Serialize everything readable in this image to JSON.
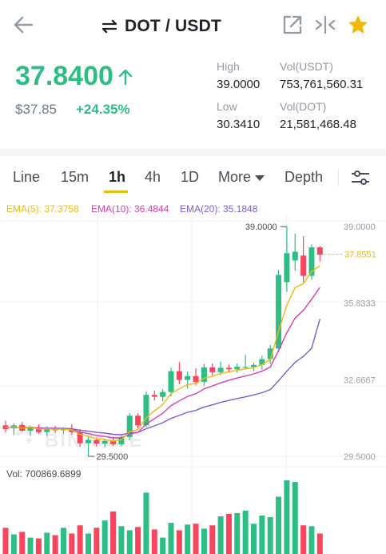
{
  "header": {
    "title": "DOT / USDT",
    "back_icon": "back-arrow-icon",
    "swap_icon": "swap-arrows-icon",
    "share_icon": "external-share-icon",
    "compare_icon": "collapse-compare-icon",
    "favorite_icon": "star-icon",
    "accent_color": "#f0b90b"
  },
  "summary": {
    "last_price": "37.8400",
    "fiat_price": "$37.85",
    "change_pct": "+24.35%",
    "up_color": "#2ebd85",
    "down_color": "#f6465d",
    "high_label": "High",
    "high_value": "39.0000",
    "low_label": "Low",
    "low_value": "30.3410",
    "vol_quote_label": "Vol(USDT)",
    "vol_quote_value": "753,761,560.31",
    "vol_base_label": "Vol(DOT)",
    "vol_base_value": "21,581,468.48"
  },
  "tabs": [
    {
      "label": "Line"
    },
    {
      "label": "15m"
    },
    {
      "label": "1h",
      "active": true
    },
    {
      "label": "4h"
    },
    {
      "label": "1D"
    },
    {
      "label": "More"
    },
    {
      "label": "Depth"
    }
  ],
  "settings_icon": "sliders-settings-icon",
  "ema": {
    "ema5": "EMA(5): 37.3758",
    "ema10": "EMA(10): 36.4844",
    "ema20": "EMA(20): 35.1848",
    "ema5_color": "#f0b90b",
    "ema10_color": "#d63fb0",
    "ema20_color": "#7b5bd6"
  },
  "chart_data": {
    "type": "candlestick",
    "y_ticks": [
      "39.0000",
      "35.8333",
      "32.6667",
      "29.5000"
    ],
    "ylim": [
      29.5,
      39.0
    ],
    "high_marker": "39.0000",
    "low_marker": "29.5000",
    "last_price_marker": "37.8551",
    "watermark": "BINANCE",
    "volume_label": "Vol: 700869.6899",
    "candles": [
      {
        "o": 30.78,
        "h": 30.98,
        "l": 30.48,
        "c": 30.62
      },
      {
        "o": 30.66,
        "h": 30.86,
        "l": 30.38,
        "c": 30.78
      },
      {
        "o": 30.8,
        "h": 30.92,
        "l": 30.5,
        "c": 30.56
      },
      {
        "o": 30.56,
        "h": 30.76,
        "l": 30.34,
        "c": 30.72
      },
      {
        "o": 30.7,
        "h": 30.82,
        "l": 30.44,
        "c": 30.5
      },
      {
        "o": 30.5,
        "h": 30.74,
        "l": 30.34,
        "c": 30.66
      },
      {
        "o": 30.66,
        "h": 30.76,
        "l": 30.46,
        "c": 30.58
      },
      {
        "o": 30.58,
        "h": 30.7,
        "l": 30.42,
        "c": 30.64
      },
      {
        "o": 30.64,
        "h": 30.82,
        "l": 30.4,
        "c": 30.5
      },
      {
        "o": 30.5,
        "h": 30.62,
        "l": 29.9,
        "c": 30.04
      },
      {
        "o": 30.04,
        "h": 30.3,
        "l": 29.5,
        "c": 30.18
      },
      {
        "o": 30.18,
        "h": 30.28,
        "l": 29.9,
        "c": 30.02
      },
      {
        "o": 30.02,
        "h": 30.22,
        "l": 29.86,
        "c": 30.14
      },
      {
        "o": 30.14,
        "h": 30.32,
        "l": 29.92,
        "c": 30.0
      },
      {
        "o": 30.0,
        "h": 30.4,
        "l": 29.92,
        "c": 30.3
      },
      {
        "o": 30.3,
        "h": 31.28,
        "l": 30.16,
        "c": 31.18
      },
      {
        "o": 31.18,
        "h": 31.28,
        "l": 30.66,
        "c": 30.78
      },
      {
        "o": 30.78,
        "h": 32.18,
        "l": 30.7,
        "c": 32.04
      },
      {
        "o": 32.04,
        "h": 32.22,
        "l": 31.82,
        "c": 31.96
      },
      {
        "o": 31.96,
        "h": 32.28,
        "l": 31.76,
        "c": 32.16
      },
      {
        "o": 32.16,
        "h": 33.16,
        "l": 31.98,
        "c": 33.02
      },
      {
        "o": 33.02,
        "h": 33.4,
        "l": 32.48,
        "c": 32.66
      },
      {
        "o": 32.66,
        "h": 33.0,
        "l": 32.3,
        "c": 32.82
      },
      {
        "o": 32.82,
        "h": 33.14,
        "l": 32.44,
        "c": 32.58
      },
      {
        "o": 32.58,
        "h": 33.32,
        "l": 32.42,
        "c": 33.18
      },
      {
        "o": 33.18,
        "h": 33.34,
        "l": 32.84,
        "c": 32.98
      },
      {
        "o": 32.98,
        "h": 33.42,
        "l": 32.86,
        "c": 33.16
      },
      {
        "o": 33.16,
        "h": 33.3,
        "l": 32.96,
        "c": 33.1
      },
      {
        "o": 33.1,
        "h": 33.34,
        "l": 32.96,
        "c": 33.2
      },
      {
        "o": 33.2,
        "h": 33.7,
        "l": 33.12,
        "c": 33.2
      },
      {
        "o": 33.2,
        "h": 33.36,
        "l": 33.02,
        "c": 33.28
      },
      {
        "o": 33.28,
        "h": 33.66,
        "l": 33.08,
        "c": 33.52
      },
      {
        "o": 33.52,
        "h": 34.1,
        "l": 33.32,
        "c": 33.96
      },
      {
        "o": 33.96,
        "h": 37.2,
        "l": 33.8,
        "c": 37.0
      },
      {
        "o": 36.7,
        "h": 39.0,
        "l": 36.3,
        "c": 37.9
      },
      {
        "o": 37.6,
        "h": 38.7,
        "l": 37.18,
        "c": 37.96
      },
      {
        "o": 37.8,
        "h": 38.6,
        "l": 36.7,
        "c": 36.96
      },
      {
        "o": 36.96,
        "h": 38.26,
        "l": 36.8,
        "c": 38.14
      },
      {
        "o": 38.14,
        "h": 38.2,
        "l": 37.56,
        "c": 37.84
      }
    ],
    "volumes": [
      3.2,
      2.4,
      2.7,
      2.0,
      1.9,
      2.6,
      2.3,
      3.2,
      2.5,
      3.5,
      2.5,
      3.2,
      4.1,
      5.2,
      3.4,
      2.9,
      3.3,
      7.5,
      3.0,
      2.0,
      3.8,
      2.9,
      3.6,
      3.7,
      3.1,
      3.5,
      4.6,
      4.9,
      5.0,
      5.3,
      3.7,
      4.7,
      4.5,
      7.0,
      9.0,
      8.8,
      3.5,
      3.4,
      2.5
    ],
    "ema5_values": [
      30.7,
      30.72,
      30.67,
      30.69,
      30.63,
      30.64,
      30.62,
      30.63,
      30.59,
      30.41,
      30.33,
      30.23,
      30.2,
      30.13,
      30.19,
      30.52,
      30.61,
      31.09,
      31.38,
      31.64,
      32.1,
      32.29,
      32.47,
      32.51,
      32.73,
      32.81,
      32.93,
      32.99,
      33.06,
      33.11,
      33.17,
      33.29,
      33.51,
      34.67,
      35.75,
      36.48,
      36.64,
      37.14,
      37.38
    ],
    "ema10_values": [
      30.7,
      30.71,
      30.68,
      30.69,
      30.66,
      30.66,
      30.64,
      30.64,
      30.61,
      30.5,
      30.44,
      30.36,
      30.32,
      30.26,
      30.26,
      30.43,
      30.49,
      30.83,
      31.06,
      31.28,
      31.6,
      31.79,
      31.98,
      32.09,
      32.29,
      32.41,
      32.54,
      32.64,
      32.74,
      32.82,
      32.91,
      33.02,
      33.19,
      33.88,
      34.61,
      35.22,
      35.54,
      35.99,
      36.48
    ],
    "ema20_values": [
      30.7,
      30.7,
      30.69,
      30.69,
      30.68,
      30.67,
      30.66,
      30.66,
      30.64,
      30.58,
      30.54,
      30.49,
      30.46,
      30.41,
      30.39,
      30.47,
      30.49,
      30.64,
      30.76,
      30.89,
      31.07,
      31.19,
      31.32,
      31.4,
      31.54,
      31.63,
      31.73,
      31.81,
      31.89,
      31.96,
      32.04,
      32.13,
      32.26,
      32.62,
      33.02,
      33.39,
      33.63,
      33.97,
      35.18
    ]
  }
}
